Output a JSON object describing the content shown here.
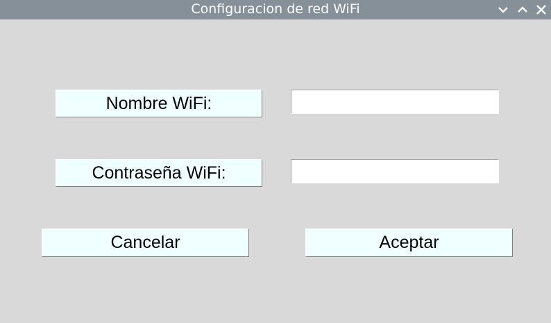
{
  "window": {
    "title": "Configuracion de red WiFi",
    "controls": [
      "chevron-down-icon",
      "chevron-up-icon",
      "close-icon"
    ]
  },
  "form": {
    "ssid_label": "Nombre WiFi:",
    "ssid_value": "",
    "password_label": "Contraseña WiFi:",
    "password_value": ""
  },
  "actions": {
    "cancel_label": "Cancelar",
    "accept_label": "Aceptar"
  },
  "colors": {
    "titlebar": "#869098",
    "background": "#d9d9d9",
    "button_face": "#f0ffff",
    "entry_bg": "#ffffff"
  }
}
